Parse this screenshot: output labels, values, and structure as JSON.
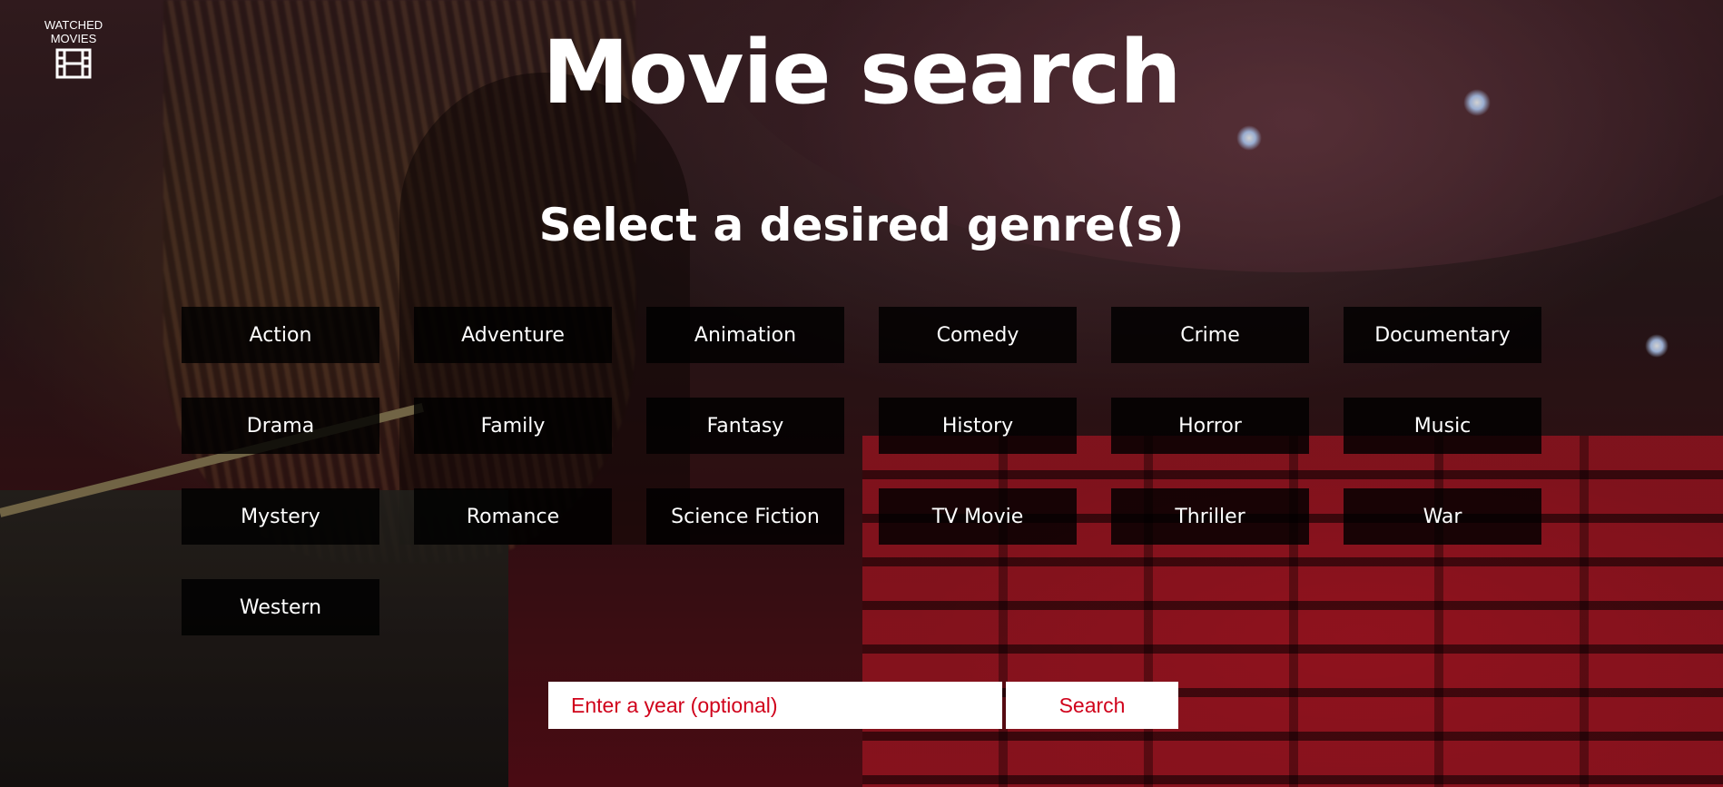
{
  "header": {
    "watched_label": "WATCHED MOVIES",
    "watched_icon": "film-icon",
    "title": "Movie search"
  },
  "genre_section": {
    "heading": "Select a desired genre(s)",
    "genres": [
      {
        "label": "Action"
      },
      {
        "label": "Adventure"
      },
      {
        "label": "Animation"
      },
      {
        "label": "Comedy"
      },
      {
        "label": "Crime"
      },
      {
        "label": "Documentary"
      },
      {
        "label": "Drama"
      },
      {
        "label": "Family"
      },
      {
        "label": "Fantasy"
      },
      {
        "label": "History"
      },
      {
        "label": "Horror"
      },
      {
        "label": "Music"
      },
      {
        "label": "Mystery"
      },
      {
        "label": "Romance"
      },
      {
        "label": "Science Fiction"
      },
      {
        "label": "TV Movie"
      },
      {
        "label": "Thriller"
      },
      {
        "label": "War"
      },
      {
        "label": "Western"
      }
    ]
  },
  "search": {
    "year_placeholder": "Enter a year (optional)",
    "year_value": "",
    "button_label": "Search"
  },
  "colors": {
    "accent": "#d0021b",
    "genre_button_bg": "#000000",
    "text": "#ffffff"
  }
}
